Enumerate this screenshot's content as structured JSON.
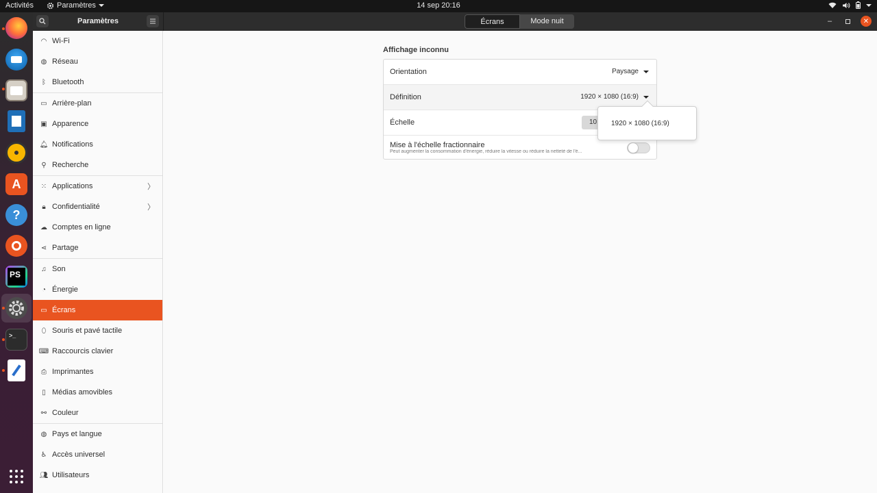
{
  "topbar": {
    "activities": "Activités",
    "app_menu": "Paramètres",
    "clock": "14 sep  20:16"
  },
  "dock": {
    "items": [
      {
        "name": "firefox"
      },
      {
        "name": "thunderbird"
      },
      {
        "name": "files"
      },
      {
        "name": "writer"
      },
      {
        "name": "rhythmbox"
      },
      {
        "name": "app-center"
      },
      {
        "name": "help"
      },
      {
        "name": "ubuntu"
      },
      {
        "name": "phpstorm",
        "label": "PS"
      },
      {
        "name": "settings"
      },
      {
        "name": "terminal"
      },
      {
        "name": "text-editor"
      }
    ]
  },
  "header": {
    "title": "Paramètres",
    "tabs": [
      {
        "label": "Écrans"
      },
      {
        "label": "Mode nuit"
      }
    ]
  },
  "sidebar": {
    "items": [
      {
        "label": "Wi-Fi"
      },
      {
        "label": "Réseau"
      },
      {
        "label": "Bluetooth"
      },
      {
        "label": "Arrière-plan"
      },
      {
        "label": "Apparence"
      },
      {
        "label": "Notifications"
      },
      {
        "label": "Recherche"
      },
      {
        "label": "Applications"
      },
      {
        "label": "Confidentialité"
      },
      {
        "label": "Comptes en ligne"
      },
      {
        "label": "Partage"
      },
      {
        "label": "Son"
      },
      {
        "label": "Énergie"
      },
      {
        "label": "Écrans"
      },
      {
        "label": "Souris et pavé tactile"
      },
      {
        "label": "Raccourcis clavier"
      },
      {
        "label": "Imprimantes"
      },
      {
        "label": "Médias amovibles"
      },
      {
        "label": "Couleur"
      },
      {
        "label": "Pays et langue"
      },
      {
        "label": "Accès universel"
      },
      {
        "label": "Utilisateurs"
      }
    ],
    "active": "Écrans"
  },
  "main": {
    "section_title": "Affichage inconnu",
    "rows": {
      "orientation": {
        "label": "Orientation",
        "value": "Paysage"
      },
      "definition": {
        "label": "Définition",
        "value": "1920 × 1080 (16:9)"
      },
      "scale": {
        "label": "Échelle",
        "value": "10"
      },
      "fractional": {
        "label": "Mise à l'échelle fractionnaire",
        "description": "Peut augmenter la consommation d'énergie, réduire la vitesse ou réduire la netteté de l'é...",
        "enabled": false
      }
    },
    "popover": {
      "option": "1920 × 1080 (16:9)"
    }
  },
  "colors": {
    "accent": "#e95420",
    "topbar": "#161616",
    "headerbar": "#2d2d2d"
  }
}
